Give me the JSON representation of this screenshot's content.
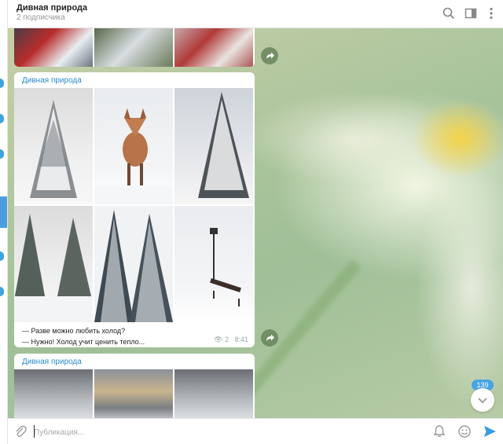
{
  "header": {
    "title": "Дивная природа",
    "subtitle": "2 подписчика",
    "icons": [
      "search-icon",
      "sidebar-toggle-icon",
      "more-icon"
    ]
  },
  "messages": [
    {
      "author": "Дивная природа",
      "caption_lines": [
        "— Разве можно любить холод?",
        "— Нужно! Холод учит ценить тепло..."
      ],
      "views": "2",
      "time": "8:41"
    },
    {
      "author": "Дивная природа"
    }
  ],
  "scroll": {
    "unread_count": "139"
  },
  "composer": {
    "placeholder": "Публикация..."
  },
  "colors": {
    "accent": "#4aa4e3",
    "author": "#2a8ccd",
    "send": "#3a9be0"
  }
}
